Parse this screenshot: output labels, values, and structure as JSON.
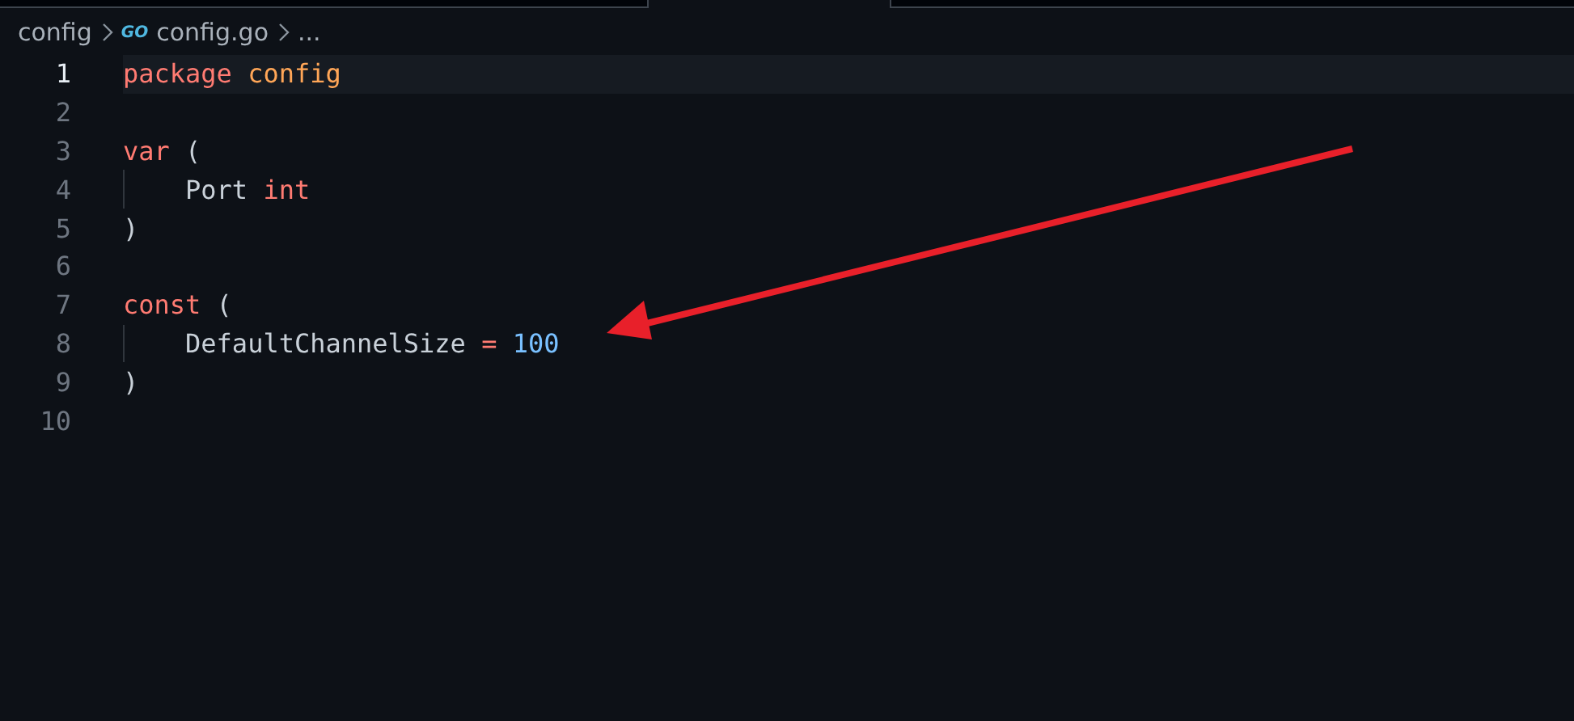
{
  "breadcrumb": [
    {
      "kind": "folder",
      "label": "config"
    },
    {
      "kind": "file",
      "icon": "GO",
      "label": "config.go"
    },
    {
      "kind": "more",
      "label": "..."
    }
  ],
  "editor": {
    "lines": [
      {
        "number": "1",
        "active": true,
        "guide": false,
        "tokens": [
          {
            "kind": "keyword",
            "text": "package "
          },
          {
            "kind": "name",
            "text": "config"
          }
        ]
      },
      {
        "number": "2",
        "active": false,
        "guide": false
      },
      {
        "number": "3",
        "active": false,
        "guide": false,
        "tokens": [
          {
            "kind": "keyword",
            "text": "var"
          },
          {
            "kind": "plain",
            "text": " ("
          }
        ]
      },
      {
        "number": "4",
        "active": false,
        "guide": true,
        "tokens": [
          {
            "kind": "plain",
            "text": "    Port "
          },
          {
            "kind": "keyword",
            "text": "int"
          }
        ]
      },
      {
        "number": "5",
        "active": false,
        "guide": false,
        "tokens": [
          {
            "kind": "plain",
            "text": ")"
          }
        ]
      },
      {
        "number": "6",
        "active": false,
        "guide": false
      },
      {
        "number": "7",
        "active": false,
        "guide": false,
        "tokens": [
          {
            "kind": "keyword",
            "text": "const"
          },
          {
            "kind": "plain",
            "text": " ("
          }
        ]
      },
      {
        "number": "8",
        "active": false,
        "guide": true,
        "tokens": [
          {
            "kind": "plain",
            "text": "    DefaultChannelSize "
          },
          {
            "kind": "keyword",
            "text": "= "
          },
          {
            "kind": "number",
            "text": "100"
          }
        ]
      },
      {
        "number": "9",
        "active": false,
        "guide": false,
        "tokens": [
          {
            "kind": "plain",
            "text": ")"
          }
        ]
      },
      {
        "number": "10",
        "active": false,
        "guide": false
      }
    ]
  }
}
